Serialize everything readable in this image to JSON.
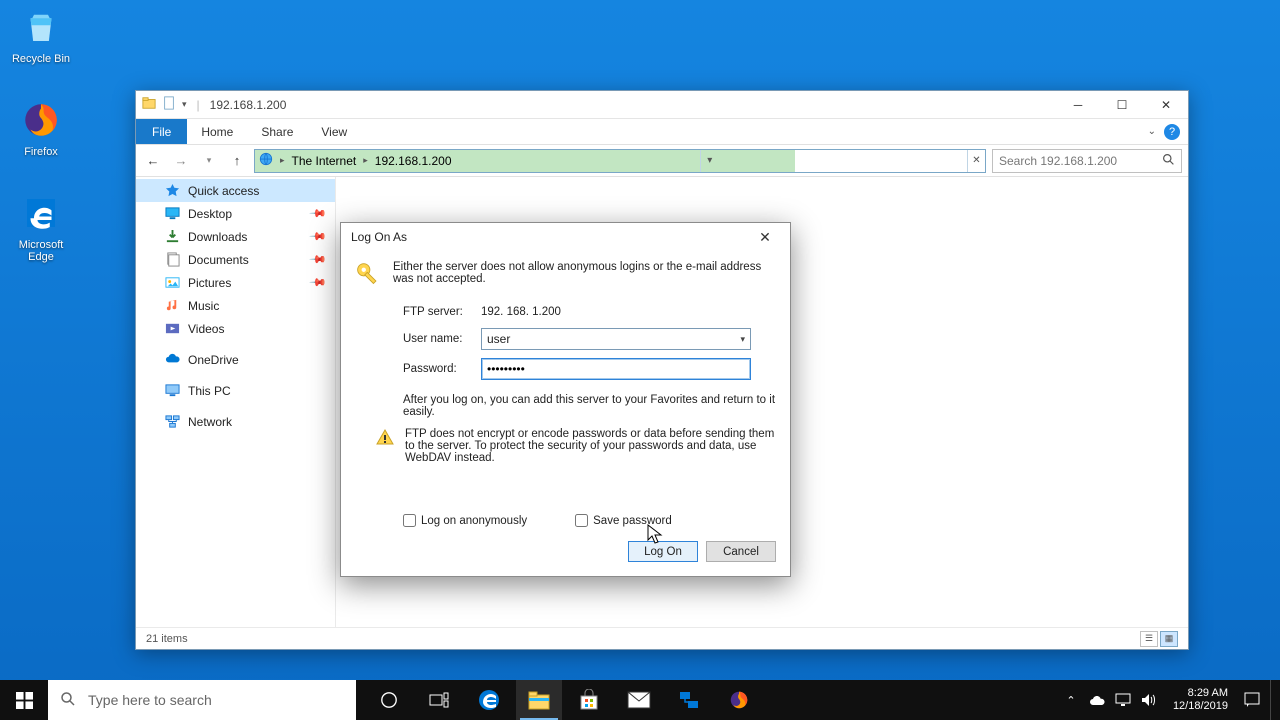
{
  "desktop": {
    "icons": [
      {
        "name": "recycle-bin-icon",
        "label": "Recycle Bin"
      },
      {
        "name": "firefox-icon",
        "label": "Firefox"
      },
      {
        "name": "edge-icon",
        "label": "Microsoft Edge"
      }
    ]
  },
  "explorer": {
    "title": "192.168.1.200",
    "ribbon": {
      "file": "File",
      "home": "Home",
      "share": "Share",
      "view": "View"
    },
    "breadcrumb": {
      "root": "The Internet",
      "current": "192.168.1.200"
    },
    "search_placeholder": "Search 192.168.1.200",
    "sidebar": {
      "quick_access": "Quick access",
      "items_pinned": [
        {
          "label": "Desktop",
          "icon": "desktop-icon"
        },
        {
          "label": "Downloads",
          "icon": "downloads-icon"
        },
        {
          "label": "Documents",
          "icon": "documents-icon"
        },
        {
          "label": "Pictures",
          "icon": "pictures-icon"
        },
        {
          "label": "Music",
          "icon": "music-icon"
        },
        {
          "label": "Videos",
          "icon": "videos-icon"
        }
      ],
      "onedrive": "OneDrive",
      "this_pc": "This PC",
      "network": "Network"
    },
    "status": {
      "item_count_label": "21 items"
    }
  },
  "dialog": {
    "title": "Log On As",
    "message": "Either the server does not allow anonymous logins or the e-mail address was not accepted.",
    "ftp_label": "FTP server:",
    "ftp_value": "192. 168. 1.200",
    "user_label": "User name:",
    "user_value": "user",
    "pass_label": "Password:",
    "pass_value": "•••••••••",
    "info": "After you log on, you can add this server to your Favorites and return to it easily.",
    "warning": "FTP does not encrypt or encode passwords or data before sending them to the server.  To protect the security of your passwords and data, use WebDAV instead.",
    "anon_label": "Log on anonymously",
    "save_label": "Save password",
    "logon_btn": "Log On",
    "cancel_btn": "Cancel"
  },
  "taskbar": {
    "search_placeholder": "Type here to search",
    "time": "8:29 AM",
    "date": "12/18/2019"
  }
}
